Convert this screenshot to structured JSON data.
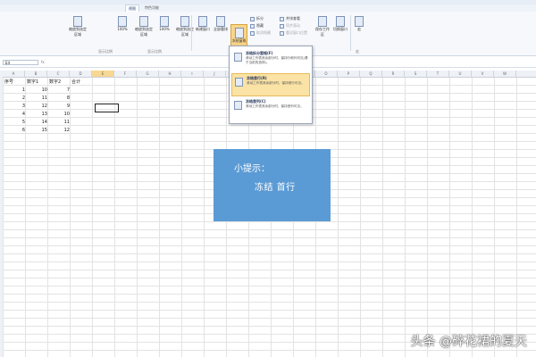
{
  "ribbon": {
    "active_tab": "视图",
    "tab_other": "特色功能",
    "buttons": {
      "zoom_selection": "缩放到选定区域",
      "zoom_100": "100%",
      "new_window": "新建窗口",
      "arrange_all": "全部重排",
      "freeze_panes": "冻结窗格",
      "split": "拆分",
      "hide": "隐藏",
      "unhide": "取消隐藏",
      "side_by_side": "并排查看",
      "sync_scroll": "同步滚动",
      "reset_position": "重设窗口位置",
      "save_workspace": "保存工作区",
      "switch_windows": "切换窗口",
      "macros": "宏"
    },
    "groups": {
      "zoom": "显示比例",
      "window": "窗口",
      "macro": "宏"
    }
  },
  "namebox": "E4",
  "fx": "fx",
  "columns": [
    "A",
    "B",
    "C",
    "D",
    "E",
    "F",
    "G",
    "H",
    "I",
    "J",
    "K",
    "L",
    "M",
    "N",
    "O",
    "P",
    "Q",
    "R",
    "S",
    "T",
    "U",
    "V",
    "W"
  ],
  "table": {
    "headers": [
      "序号",
      "数字1",
      "数字2",
      "合计"
    ],
    "rows": [
      [
        "1",
        "10",
        "7"
      ],
      [
        "2",
        "11",
        "8"
      ],
      [
        "3",
        "12",
        "9"
      ],
      [
        "4",
        "13",
        "10"
      ],
      [
        "5",
        "14",
        "11"
      ],
      [
        "6",
        "15",
        "12"
      ]
    ]
  },
  "dropdown": {
    "items": [
      {
        "title": "冻结拆分窗格(F)",
        "desc": "滚动工作表其余部分时，保持行和列可见(基于当前的选择)。"
      },
      {
        "title": "冻结首行(R)",
        "desc": "滚动工作表其余部分时，保持首行可见。"
      },
      {
        "title": "冻结首列(C)",
        "desc": "滚动工作表其余部分时，保持首列可见。"
      }
    ]
  },
  "tip": {
    "title": "小提示：",
    "body": "冻结  首行"
  },
  "watermark": "头条 @碎花裙的夏天",
  "colors": {
    "tip_bg": "#5b9bd5",
    "highlight": "#fbe3a6",
    "freeze_btn": "#f9d58a"
  }
}
